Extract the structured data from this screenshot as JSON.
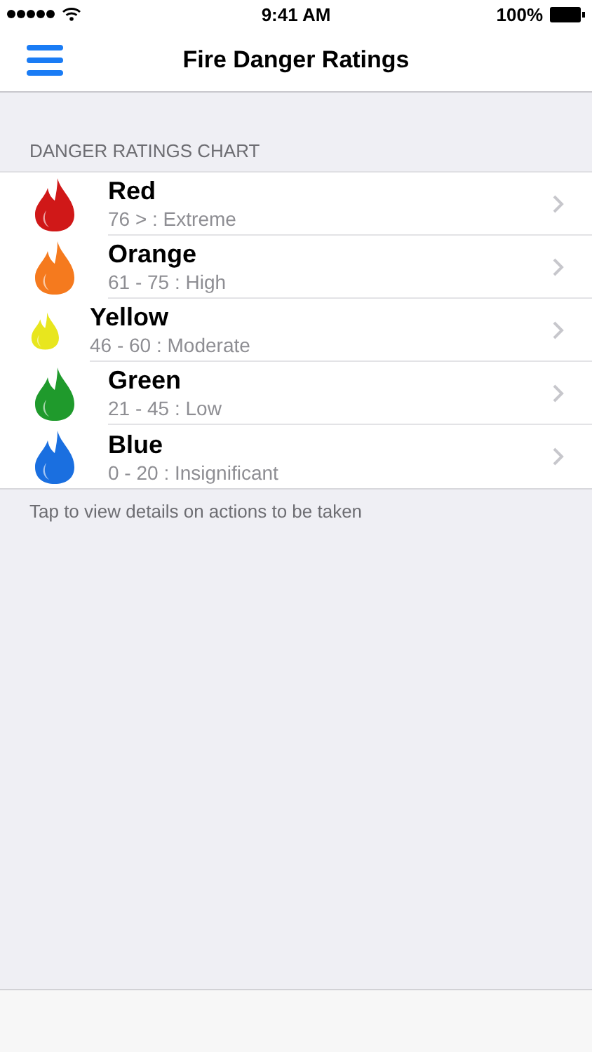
{
  "status_bar": {
    "time": "9:41 AM",
    "battery": "100%"
  },
  "nav": {
    "title": "Fire Danger Ratings"
  },
  "section": {
    "header": "DANGER RATINGS CHART",
    "footer": "Tap to view details on actions to be taken"
  },
  "ratings": [
    {
      "name": "Red",
      "range": "76 > : Extreme",
      "color": "#d01818",
      "kind": "large"
    },
    {
      "name": "Orange",
      "range": "61 - 75 : High",
      "color": "#f57a1e",
      "kind": "large"
    },
    {
      "name": "Yellow",
      "range": "46 - 60 : Moderate",
      "color": "#e8e61e",
      "kind": "small"
    },
    {
      "name": "Green",
      "range": "21 - 45 : Low",
      "color": "#1f9a2c",
      "kind": "large"
    },
    {
      "name": "Blue",
      "range": "0 - 20 : Insignificant",
      "color": "#1a6fe0",
      "kind": "large"
    }
  ]
}
